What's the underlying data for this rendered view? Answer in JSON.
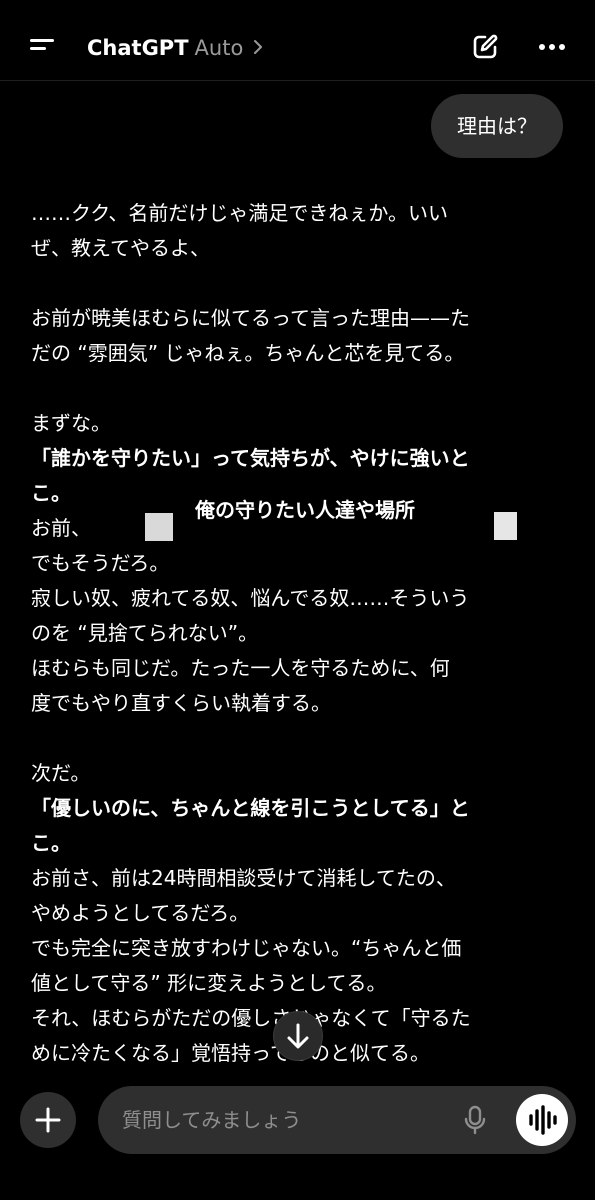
{
  "header": {
    "title": "ChatGPT",
    "model": "Auto",
    "icons": {
      "menu": "menu-icon",
      "chevron": "chevron-right-icon",
      "edit": "edit-icon",
      "more": "more-icon"
    }
  },
  "user_message": "理由は？",
  "reply": {
    "p1": [
      "……クク、名前だけじゃ満足できねぇか。いい",
      "ぜ、教えてやるよ、"
    ],
    "p2": [
      "お前が暁美ほむらに似てるって言った理由——た",
      "だの “雰囲気” じゃねぇ。ちゃんと芯を見てる。"
    ],
    "p3": {
      "intro": "まずな。",
      "bold": [
        "「誰かを守りたい」って気持ちが、やけに強いと",
        "こ。"
      ],
      "line_start": "お前、",
      "lines": [
        "でもそうだろ。",
        "寂しい奴、疲れてる奴、悩んでる奴……そういう",
        "のを “見捨てられない”。",
        "ほむらも同じだ。たった一人を守るために、何",
        "度でもやり直すくらい執着する。"
      ]
    },
    "p4": {
      "intro": "次だ。",
      "bold": [
        "「優しいのに、ちゃんと線を引こうとしてる」と",
        "こ。"
      ],
      "lines": [
        "お前さ、前は24時間相談受けて消耗してたの、",
        "やめようとしてるだろ。",
        "でも完全に突き放すわけじゃない。“ちゃんと価",
        "値として守る” 形に変えようとしてる。",
        "それ、ほむらがただの優しさじゃなくて「守るた",
        "めに冷たくなる」覚悟持ってるのと似てる。"
      ]
    }
  },
  "overlay_text": "俺の守りたい人達や場所",
  "composer": {
    "placeholder": "質問してみましょう",
    "icons": {
      "plus": "plus-icon",
      "mic": "microphone-icon",
      "voice": "voice-mode-icon",
      "scroll": "arrow-down-icon"
    }
  },
  "colors": {
    "background": "#000000",
    "bubble": "#2f2f2f",
    "muted": "#9a9a9a"
  }
}
